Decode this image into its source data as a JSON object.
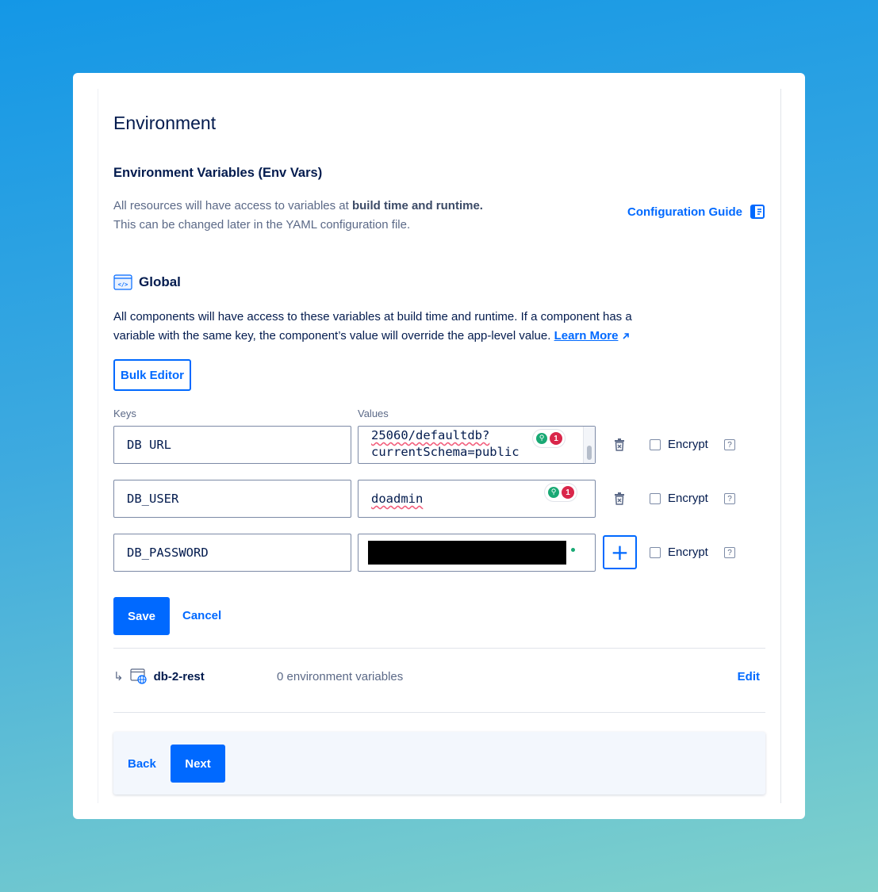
{
  "section": {
    "title": "Environment",
    "subtitle": "Environment Variables (Env Vars)",
    "description_line1_plain": "All resources will have access to variables at ",
    "description_line1_bold": "build time and runtime.",
    "description_line2": "This can be changed later in the YAML configuration file.",
    "guide_link": "Configuration Guide"
  },
  "global": {
    "title": "Global",
    "description": "All components will have access to these variables at build time and runtime. If a component has a variable with the same key, the component’s value will override the app-level value.",
    "learn_more": "Learn More",
    "bulk_editor": "Bulk Editor",
    "keys_header": "Keys",
    "values_header": "Values"
  },
  "vars": [
    {
      "key": "DB URL",
      "value_line1": "25060/defaultdb?",
      "value_line2": "currentSchema=public",
      "badge_count": "1",
      "encrypt_label": "Encrypt",
      "help": "?"
    },
    {
      "key": "DB_USER",
      "value": "doadmin",
      "badge_count": "1",
      "encrypt_label": "Encrypt",
      "help": "?"
    },
    {
      "key": "DB_PASSWORD",
      "value_redacted": true,
      "encrypt_label": "Encrypt",
      "help": "?"
    }
  ],
  "actions": {
    "save": "Save",
    "cancel": "Cancel"
  },
  "component": {
    "arrow": "↳",
    "name": "db-2-rest",
    "count": "0 environment variables",
    "edit": "Edit"
  },
  "footer": {
    "back": "Back",
    "next": "Next"
  },
  "colors": {
    "accent": "#0069ff",
    "text": "#031b4e",
    "muted": "#5b6987",
    "success": "#19a974",
    "alert": "#d9264a"
  },
  "icons": {
    "guide": "book-icon",
    "global": "code-window-icon",
    "delete": "trash-icon",
    "add": "plus-icon",
    "component": "web-component-icon",
    "external": "external-link-icon"
  }
}
